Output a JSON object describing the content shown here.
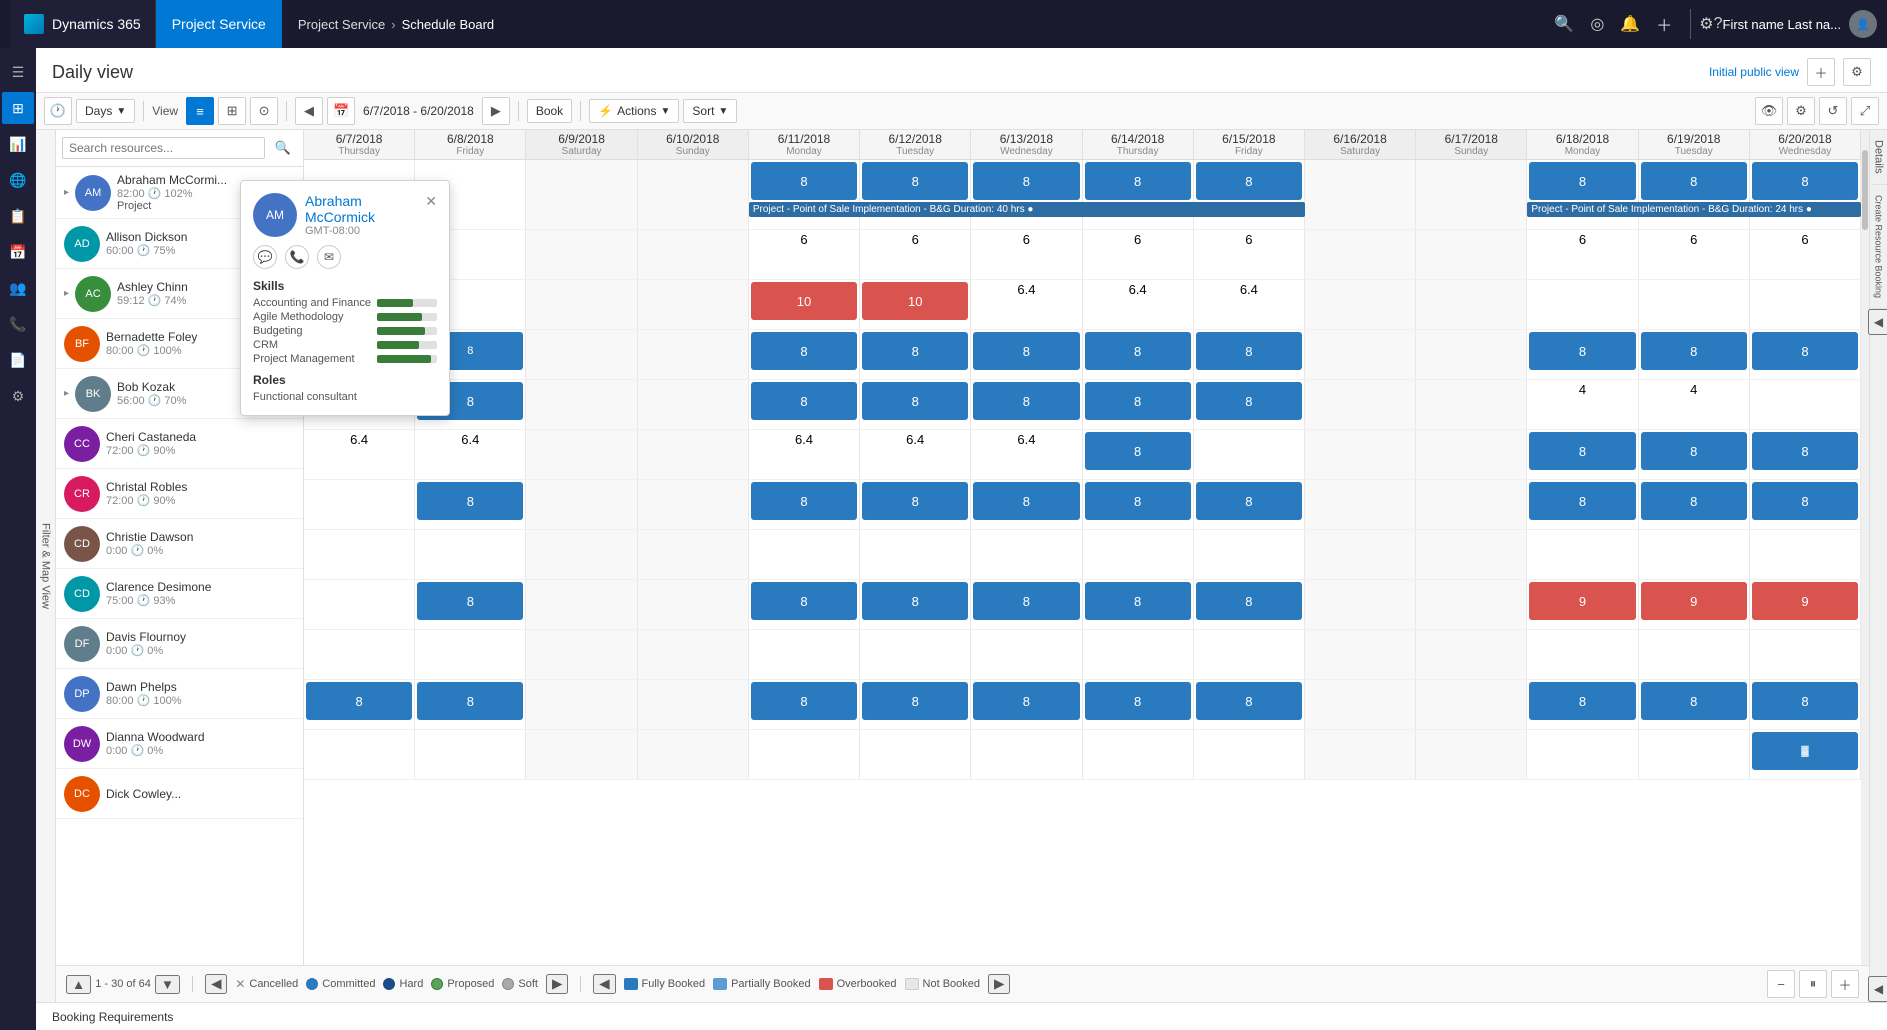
{
  "topNav": {
    "brand": "Dynamics 365",
    "module": "Project Service",
    "breadcrumb": [
      "Project Service",
      "Schedule Board"
    ],
    "userLabel": "First name Last na...",
    "icons": [
      "search",
      "target",
      "notification",
      "plus"
    ]
  },
  "page": {
    "title": "Daily view",
    "initialPublicView": "Initial public view"
  },
  "toolbar": {
    "daysLabel": "Days",
    "viewLabel": "View",
    "dateRange": "6/7/2018 - 6/20/2018",
    "bookLabel": "Book",
    "actionsLabel": "Actions",
    "sortLabel": "Sort"
  },
  "filterSidebar": {
    "label": "Filter & Map View"
  },
  "resourceSearch": {
    "placeholder": "Search resources..."
  },
  "resources": [
    {
      "id": "r1",
      "name": "Abraham McCormi...",
      "hours": "82:00",
      "util": "102%",
      "sub": "Project",
      "color": "av-blue"
    },
    {
      "id": "r2",
      "name": "Allison Dickson",
      "hours": "60:00",
      "util": "75%",
      "sub": "",
      "color": "av-teal"
    },
    {
      "id": "r3",
      "name": "Ashley Chinn",
      "hours": "59:12",
      "util": "74%",
      "sub": "",
      "color": "av-green"
    },
    {
      "id": "r4",
      "name": "Bernadette Foley",
      "hours": "80:00",
      "util": "100%",
      "sub": "",
      "color": "av-orange"
    },
    {
      "id": "r5",
      "name": "Bob Kozak",
      "hours": "56:00",
      "util": "70%",
      "sub": "",
      "color": "av-gray"
    },
    {
      "id": "r6",
      "name": "Cheri Castaneda",
      "hours": "72:00",
      "util": "90%",
      "sub": "",
      "color": "av-purple"
    },
    {
      "id": "r7",
      "name": "Christal Robles",
      "hours": "72:00",
      "util": "90%",
      "sub": "",
      "color": "av-pink"
    },
    {
      "id": "r8",
      "name": "Christie Dawson",
      "hours": "0:00",
      "util": "0%",
      "sub": "",
      "color": "av-brown"
    },
    {
      "id": "r9",
      "name": "Clarence Desimone",
      "hours": "75:00",
      "util": "93%",
      "sub": "",
      "color": "av-teal"
    },
    {
      "id": "r10",
      "name": "Davis Flournoy",
      "hours": "0:00",
      "util": "0%",
      "sub": "",
      "color": "av-gray"
    },
    {
      "id": "r11",
      "name": "Dawn Phelps",
      "hours": "80:00",
      "util": "100%",
      "sub": "",
      "color": "av-blue"
    },
    {
      "id": "r12",
      "name": "Dianna Woodward",
      "hours": "0:00",
      "util": "0%",
      "sub": "",
      "color": "av-purple"
    },
    {
      "id": "r13",
      "name": "Dick Cowley...",
      "hours": "",
      "util": "",
      "sub": "",
      "color": "av-orange"
    }
  ],
  "dates": [
    {
      "date": "6/7/2018",
      "day": "Thursday",
      "weekend": false
    },
    {
      "date": "6/8/2018",
      "day": "Friday",
      "weekend": false
    },
    {
      "date": "6/9/2018",
      "day": "Saturday",
      "weekend": true
    },
    {
      "date": "6/10/2018",
      "day": "Sunday",
      "weekend": true
    },
    {
      "date": "6/11/2018",
      "day": "Monday",
      "weekend": false
    },
    {
      "date": "6/12/2018",
      "day": "Tuesday",
      "weekend": false
    },
    {
      "date": "6/13/2018",
      "day": "Wednesday",
      "weekend": false
    },
    {
      "date": "6/14/2018",
      "day": "Thursday",
      "weekend": false
    },
    {
      "date": "6/15/2018",
      "day": "Friday",
      "weekend": false
    },
    {
      "date": "6/16/2018",
      "day": "Saturday",
      "weekend": true
    },
    {
      "date": "6/17/2018",
      "day": "Sunday",
      "weekend": true
    },
    {
      "date": "6/18/2018",
      "day": "Monday",
      "weekend": false
    },
    {
      "date": "6/19/2018",
      "day": "Tuesday",
      "weekend": false
    },
    {
      "date": "6/20/2018",
      "day": "Wednesday",
      "weekend": false
    }
  ],
  "popup": {
    "name": "Abraham McCormick",
    "tz": "GMT-08:00",
    "skills": [
      {
        "name": "Accounting and Finance",
        "pct": 60
      },
      {
        "name": "Agile Methodology",
        "pct": 75
      },
      {
        "name": "Budgeting",
        "pct": 80
      },
      {
        "name": "CRM",
        "pct": 70
      },
      {
        "name": "Project Management",
        "pct": 90
      }
    ],
    "roles": [
      "Functional consultant"
    ]
  },
  "legend": {
    "cancelled": "Cancelled",
    "committed": "Committed",
    "hard": "Hard",
    "proposed": "Proposed",
    "soft": "Soft",
    "fullyBooked": "Fully Booked",
    "partiallyBooked": "Partially Booked",
    "overbooked": "Overbooked",
    "notBooked": "Not Booked"
  },
  "pagination": {
    "label": "1 - 30 of 64"
  },
  "bookingReq": {
    "label": "Booking Requirements"
  }
}
